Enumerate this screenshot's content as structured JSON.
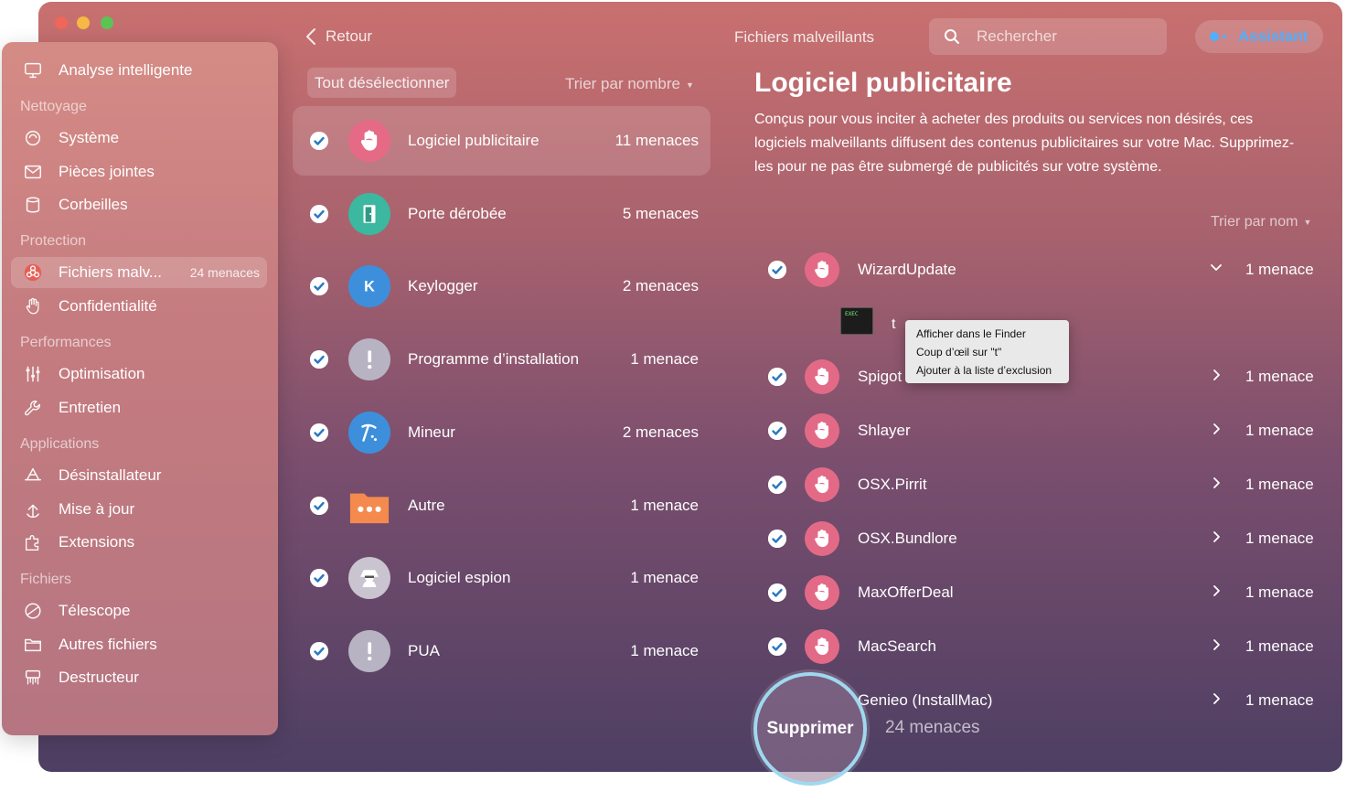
{
  "window": {
    "controls": [
      "close",
      "minimize",
      "zoom"
    ]
  },
  "sidebar": {
    "top_item": {
      "label": "Analyse intelligente",
      "icon": "monitor-icon"
    },
    "sections": [
      {
        "title": "Nettoyage",
        "items": [
          {
            "label": "Système",
            "icon": "system-icon"
          },
          {
            "label": "Pièces jointes",
            "icon": "mail-icon"
          },
          {
            "label": "Corbeilles",
            "icon": "trash-icon"
          }
        ]
      },
      {
        "title": "Protection",
        "items": [
          {
            "label": "Fichiers malv...",
            "icon": "biohazard-icon",
            "count": "24 menaces",
            "active": true
          },
          {
            "label": "Confidentialité",
            "icon": "hand-icon"
          }
        ]
      },
      {
        "title": "Performances",
        "items": [
          {
            "label": "Optimisation",
            "icon": "sliders-icon"
          },
          {
            "label": "Entretien",
            "icon": "wrench-icon"
          }
        ]
      },
      {
        "title": "Applications",
        "items": [
          {
            "label": "Désinstallateur",
            "icon": "appstore-icon"
          },
          {
            "label": "Mise à jour",
            "icon": "update-icon"
          },
          {
            "label": "Extensions",
            "icon": "extensions-icon"
          }
        ]
      },
      {
        "title": "Fichiers",
        "items": [
          {
            "label": "Télescope",
            "icon": "telescope-icon"
          },
          {
            "label": "Autres fichiers",
            "icon": "folder-icon"
          },
          {
            "label": "Destructeur",
            "icon": "shredder-icon"
          }
        ]
      }
    ]
  },
  "header": {
    "back_label": "Retour",
    "page_title": "Fichiers malveillants",
    "search_placeholder": "Rechercher",
    "assistant_label": "Assistant"
  },
  "categories_panel": {
    "deselect_label": "Tout désélectionner",
    "sort_label": "Trier par nombre",
    "items": [
      {
        "name": "Logiciel publicitaire",
        "count": "11 menaces",
        "icon": "stop-hand-icon",
        "color": "#e56a86",
        "selected": true
      },
      {
        "name": "Porte dérobée",
        "count": "5 menaces",
        "icon": "door-icon",
        "color": "#3cb7a0",
        "selected": false
      },
      {
        "name": "Keylogger",
        "count": "2 menaces",
        "icon": "keylogger-k-icon",
        "color": "#3d8fdc",
        "selected": false
      },
      {
        "name": "Programme d’installation",
        "count": "1 menace",
        "icon": "exclamation-icon",
        "color": "#b8b3c2",
        "selected": false
      },
      {
        "name": "Mineur",
        "count": "2 menaces",
        "icon": "pickaxe-icon",
        "color": "#3d8fdc",
        "selected": false
      },
      {
        "name": "Autre",
        "count": "1 menace",
        "icon": "orange-folder-icon",
        "color": "#f2884d",
        "selected": false
      },
      {
        "name": "Logiciel espion",
        "count": "1 menace",
        "icon": "spy-icon",
        "color": "#c9c4cf",
        "selected": false
      },
      {
        "name": "PUA",
        "count": "1 menace",
        "icon": "exclamation-icon",
        "color": "#b8b3c2",
        "selected": false
      }
    ]
  },
  "detail": {
    "title": "Logiciel publicitaire",
    "description": "Conçus pour vous inciter à acheter des produits ou services non désirés, ces logiciels malveillants diffusent des contenus publicitaires sur votre Mac. Supprimez-les pour ne pas être submergé de publicités sur votre système.",
    "sort_label": "Trier par nom",
    "threats": [
      {
        "name": "WizardUpdate",
        "count": "1 menace",
        "expanded": true
      },
      {
        "name": "Spigot",
        "count": "1 menace"
      },
      {
        "name": "Shlayer",
        "count": "1 menace"
      },
      {
        "name": "OSX.Pirrit",
        "count": "1 menace"
      },
      {
        "name": "OSX.Bundlore",
        "count": "1 menace"
      },
      {
        "name": "MaxOfferDeal",
        "count": "1 menace"
      },
      {
        "name": "MacSearch",
        "count": "1 menace"
      },
      {
        "name": "Genieo (InstallMac)",
        "count": "1 menace"
      }
    ],
    "expanded_file": {
      "name": "t",
      "thumb_text": "EXEC"
    }
  },
  "context_menu": {
    "items": [
      "Afficher dans le Finder",
      "Coup d’œil sur \"t\"",
      "Ajouter à la liste d’exclusion"
    ]
  },
  "footer": {
    "delete_label": "Supprimer",
    "total_count": "24 menaces"
  },
  "colors": {
    "accent_blue": "#4fb0ff",
    "delete_ring": "#9fd8ef",
    "threat_icon": "#e36a87"
  }
}
